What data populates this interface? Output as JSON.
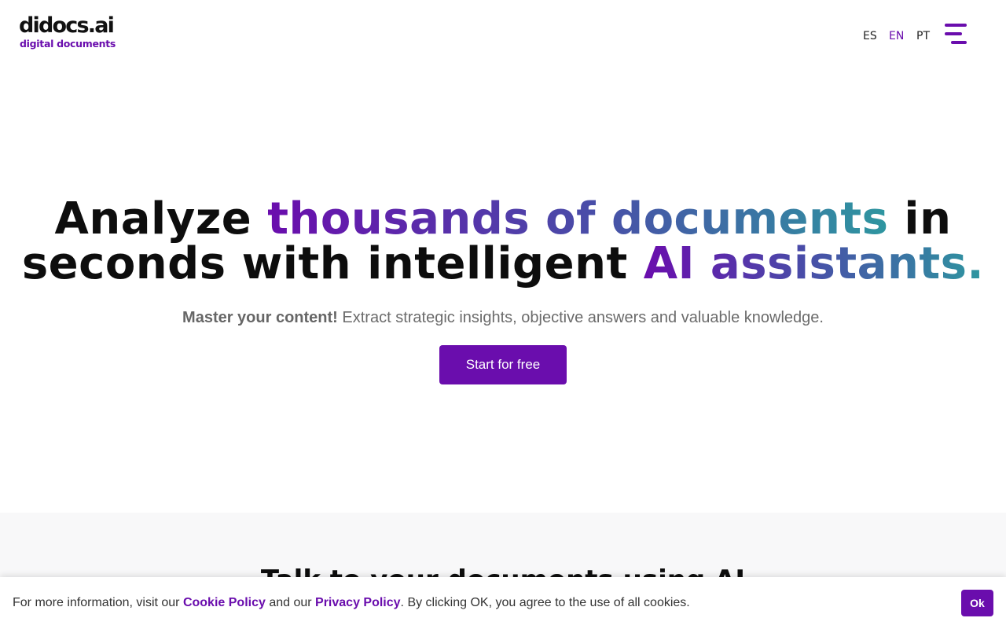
{
  "header": {
    "logo_main": "didocs.ai",
    "logo_sub": "digital documents",
    "languages": [
      {
        "label": "ES",
        "active": false
      },
      {
        "label": "EN",
        "active": true
      },
      {
        "label": "PT",
        "active": false
      }
    ],
    "menu_icon": "hamburger-menu-icon"
  },
  "hero": {
    "title_part1": "Analyze ",
    "title_highlight1": "thousands of documents",
    "title_part2": " in seconds with intelligent ",
    "title_highlight2": "AI assistants.",
    "subtitle_bold": "Master your content!",
    "subtitle_rest": " Extract strategic insights, objective answers and valuable knowledge.",
    "cta_label": "Start for free"
  },
  "section2": {
    "title": "Talk to your documents using AI"
  },
  "cookie": {
    "text_before": "For more information, visit our ",
    "cookie_policy_label": "Cookie Policy",
    "text_middle": " and our ",
    "privacy_policy_label": "Privacy Policy",
    "text_after": ". By clicking OK, you agree to the use of all cookies.",
    "ok_label": "Ok"
  },
  "colors": {
    "brand": "#6a0dad",
    "gradient_end": "#2e96a0"
  }
}
